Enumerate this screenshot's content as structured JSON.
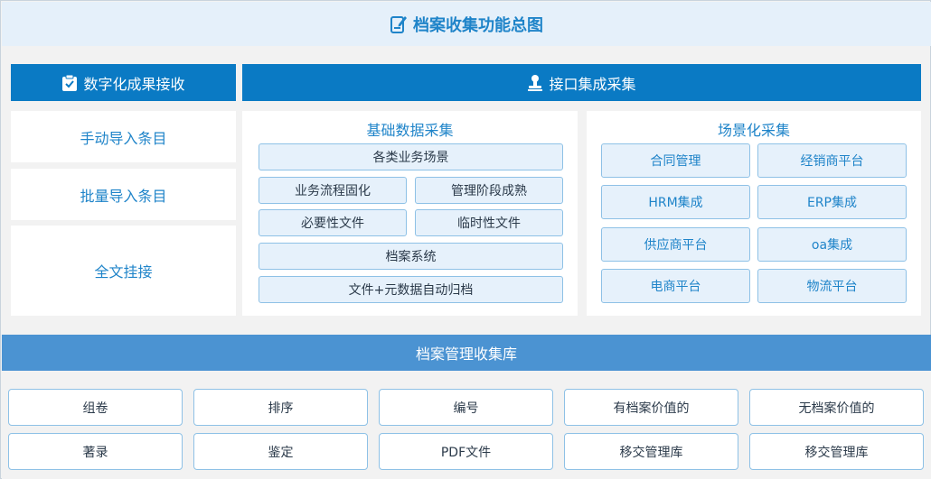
{
  "title": "档案收集功能总图",
  "left_header": "数字化成果接收",
  "left_items": [
    "手动导入条目",
    "批量导入条目",
    "全文挂接"
  ],
  "interface_header": "接口集成采集",
  "basic_panel": {
    "title": "基础数据采集",
    "items": [
      "各类业务场景",
      "业务流程固化",
      "管理阶段成熟",
      "必要性文件",
      "临时性文件",
      "档案系统",
      "文件+元数据自动归档"
    ]
  },
  "scene_panel": {
    "title": "场景化采集",
    "items": [
      "合同管理",
      "经销商平台",
      "HRM集成",
      "ERP集成",
      "供应商平台",
      "oa集成",
      "电商平台",
      "物流平台"
    ]
  },
  "library_bar": "档案管理收集库",
  "library_items": [
    "组卷",
    "排序",
    "编号",
    "有档案价值的",
    "无档案价值的",
    "著录",
    "鉴定",
    "PDF文件",
    "移交管理库",
    "移交管理库"
  ],
  "colors": {
    "dark_blue": "#0a7ac4",
    "mid_blue": "#4b93d2",
    "text_blue": "#1f84c9",
    "light_box": "#e6f1fb"
  }
}
